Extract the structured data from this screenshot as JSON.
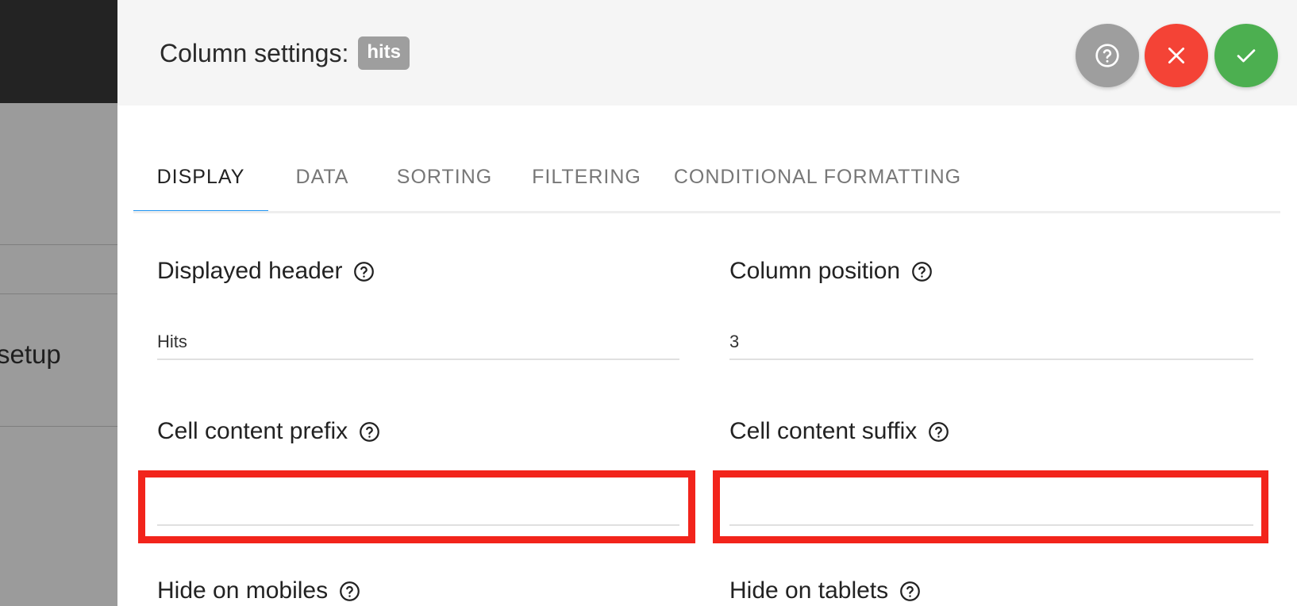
{
  "background": {
    "partial_text": "setup"
  },
  "modal": {
    "title": "Column settings:",
    "column_badge": "hits",
    "buttons": {
      "help_icon": "question-circle-icon",
      "close_icon": "close-icon",
      "confirm_icon": "check-icon"
    }
  },
  "tabs": [
    {
      "label": "DISPLAY",
      "active": true
    },
    {
      "label": "DATA",
      "active": false
    },
    {
      "label": "SORTING",
      "active": false
    },
    {
      "label": "FILTERING",
      "active": false
    },
    {
      "label": "CONDITIONAL FORMATTING",
      "active": false
    }
  ],
  "form": {
    "displayed_header": {
      "label": "Displayed header",
      "value": "Hits"
    },
    "column_position": {
      "label": "Column position",
      "value": "3"
    },
    "cell_content_prefix": {
      "label": "Cell content prefix",
      "value": ""
    },
    "cell_content_suffix": {
      "label": "Cell content suffix",
      "value": ""
    },
    "hide_on_mobiles": {
      "label": "Hide on mobiles"
    },
    "hide_on_tablets": {
      "label": "Hide on tablets"
    }
  },
  "colors": {
    "accent": "#2196f3",
    "help_button": "#9e9e9e",
    "close_button": "#f44336",
    "confirm_button": "#4caf50",
    "highlight": "#f2241b"
  }
}
